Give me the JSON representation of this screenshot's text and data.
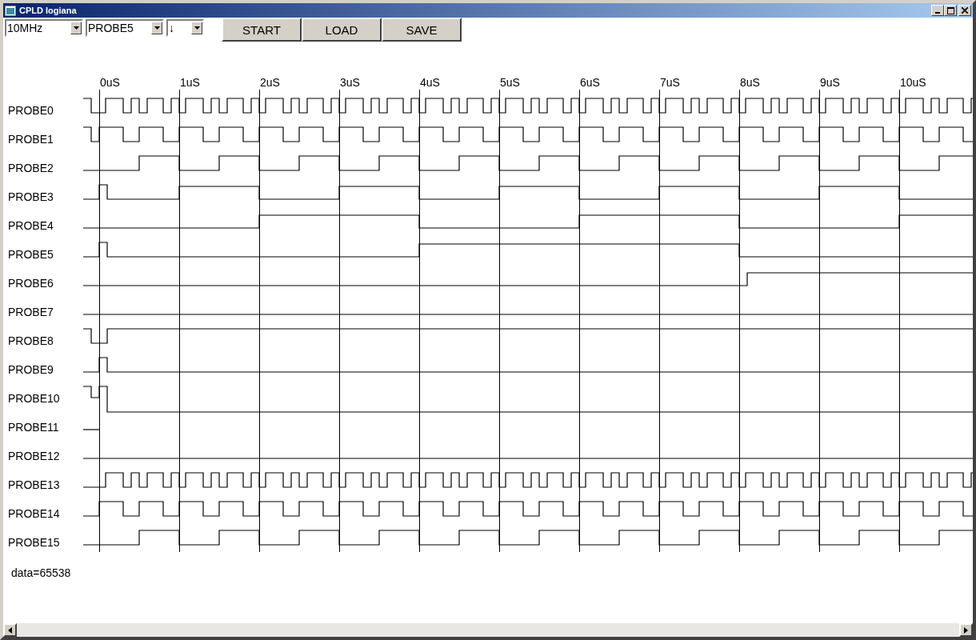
{
  "window": {
    "title": "CPLD logiana"
  },
  "toolbar": {
    "dropdowns": [
      {
        "value": "10MHz"
      },
      {
        "value": "PROBE5"
      },
      {
        "value": "↓"
      }
    ],
    "buttons": [
      "START",
      "LOAD",
      "SAVE"
    ]
  },
  "time_axis": [
    "0uS",
    "1uS",
    "2uS",
    "3uS",
    "4uS",
    "5uS",
    "6uS",
    "7uS",
    "8uS",
    "9uS",
    "10uS"
  ],
  "probes": [
    "PROBE0",
    "PROBE1",
    "PROBE2",
    "PROBE3",
    "PROBE4",
    "PROBE5",
    "PROBE6",
    "PROBE7",
    "PROBE8",
    "PROBE9",
    "PROBE10",
    "PROBE11",
    "PROBE12",
    "PROBE13",
    "PROBE14",
    "PROBE15"
  ],
  "status": "data=65538"
}
